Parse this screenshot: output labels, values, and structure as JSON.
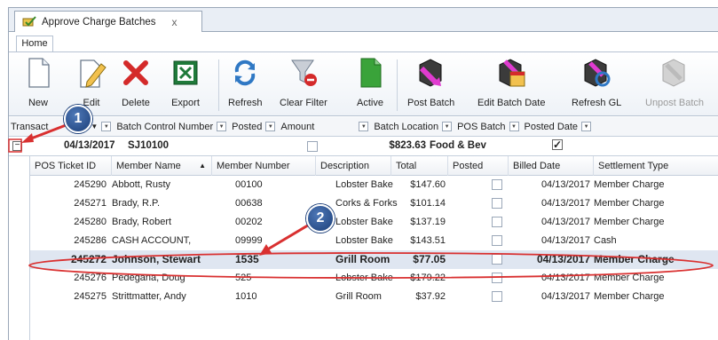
{
  "document_tab": {
    "title": "Approve Charge Batches",
    "close": "x"
  },
  "ribbon_tab": "Home",
  "toolbar": [
    {
      "label": "New",
      "icon": "new-document-icon",
      "enabled": true
    },
    {
      "label": "Edit",
      "icon": "edit-icon",
      "enabled": true
    },
    {
      "label": "Delete",
      "icon": "delete-icon",
      "enabled": true
    },
    {
      "label": "Export",
      "icon": "excel-export-icon",
      "enabled": true
    },
    {
      "label": "Refresh",
      "icon": "refresh-icon",
      "enabled": true
    },
    {
      "label": "Clear Filter",
      "icon": "clear-filter-icon",
      "enabled": true
    },
    {
      "label": "Active",
      "icon": "active-document-icon",
      "enabled": true
    },
    {
      "label": "Post Batch",
      "icon": "post-batch-icon",
      "enabled": true
    },
    {
      "label": "Edit Batch Date",
      "icon": "edit-batch-date-icon",
      "enabled": true
    },
    {
      "label": "Refresh GL",
      "icon": "refresh-gl-icon",
      "enabled": true
    },
    {
      "label": "Unpost Batch",
      "icon": "unpost-batch-icon",
      "enabled": false
    }
  ],
  "filterbar": {
    "items": [
      "Transact",
      "Batch Control Number",
      "Posted",
      "Amount",
      "Batch Location",
      "POS Batch",
      "Posted Date"
    ]
  },
  "group": {
    "date": "04/13/2017",
    "batch": "SJ10100",
    "amount": "$823.63",
    "location": "Food & Bev",
    "pos_batch": true
  },
  "columns": [
    "POS Ticket ID",
    "Member Name",
    "Member Number",
    "Description",
    "Total",
    "Posted",
    "Billed Date",
    "Settlement Type"
  ],
  "rows": [
    {
      "id": "245290",
      "name": "Abbott, Rusty",
      "number": "00100",
      "desc": "Lobster Bake",
      "total": "$147.60",
      "date": "04/13/2017",
      "type": "Member Charge"
    },
    {
      "id": "245271",
      "name": "Brady, R.P.",
      "number": "00638",
      "desc": "Corks & Forks",
      "total": "$101.14",
      "date": "04/13/2017",
      "type": "Member Charge"
    },
    {
      "id": "245280",
      "name": "Brady, Robert",
      "number": "00202",
      "desc": "Lobster Bake",
      "total": "$137.19",
      "date": "04/13/2017",
      "type": "Member Charge"
    },
    {
      "id": "245286",
      "name": "CASH ACCOUNT,",
      "number": "09999",
      "desc": "Lobster Bake",
      "total": "$143.51",
      "date": "04/13/2017",
      "type": "Cash"
    },
    {
      "id": "245272",
      "name": "Johnson, Stewart",
      "number": "1535",
      "desc": "Grill Room",
      "total": "$77.05",
      "date": "04/13/2017",
      "type": "Member Charge"
    },
    {
      "id": "245276",
      "name": "Pedegana, Doug",
      "number": "525",
      "desc": "Lobster Bake",
      "total": "$179.22",
      "date": "04/13/2017",
      "type": "Member Charge"
    },
    {
      "id": "245275",
      "name": "Strittmatter, Andy",
      "number": "1010",
      "desc": "Grill Room",
      "total": "$37.92",
      "date": "04/13/2017",
      "type": "Member Charge"
    }
  ],
  "callouts": [
    "1",
    "2"
  ],
  "colors": {
    "accent": "#1b3e78",
    "highlight": "#d93030",
    "selection": "#dfe6f1"
  }
}
